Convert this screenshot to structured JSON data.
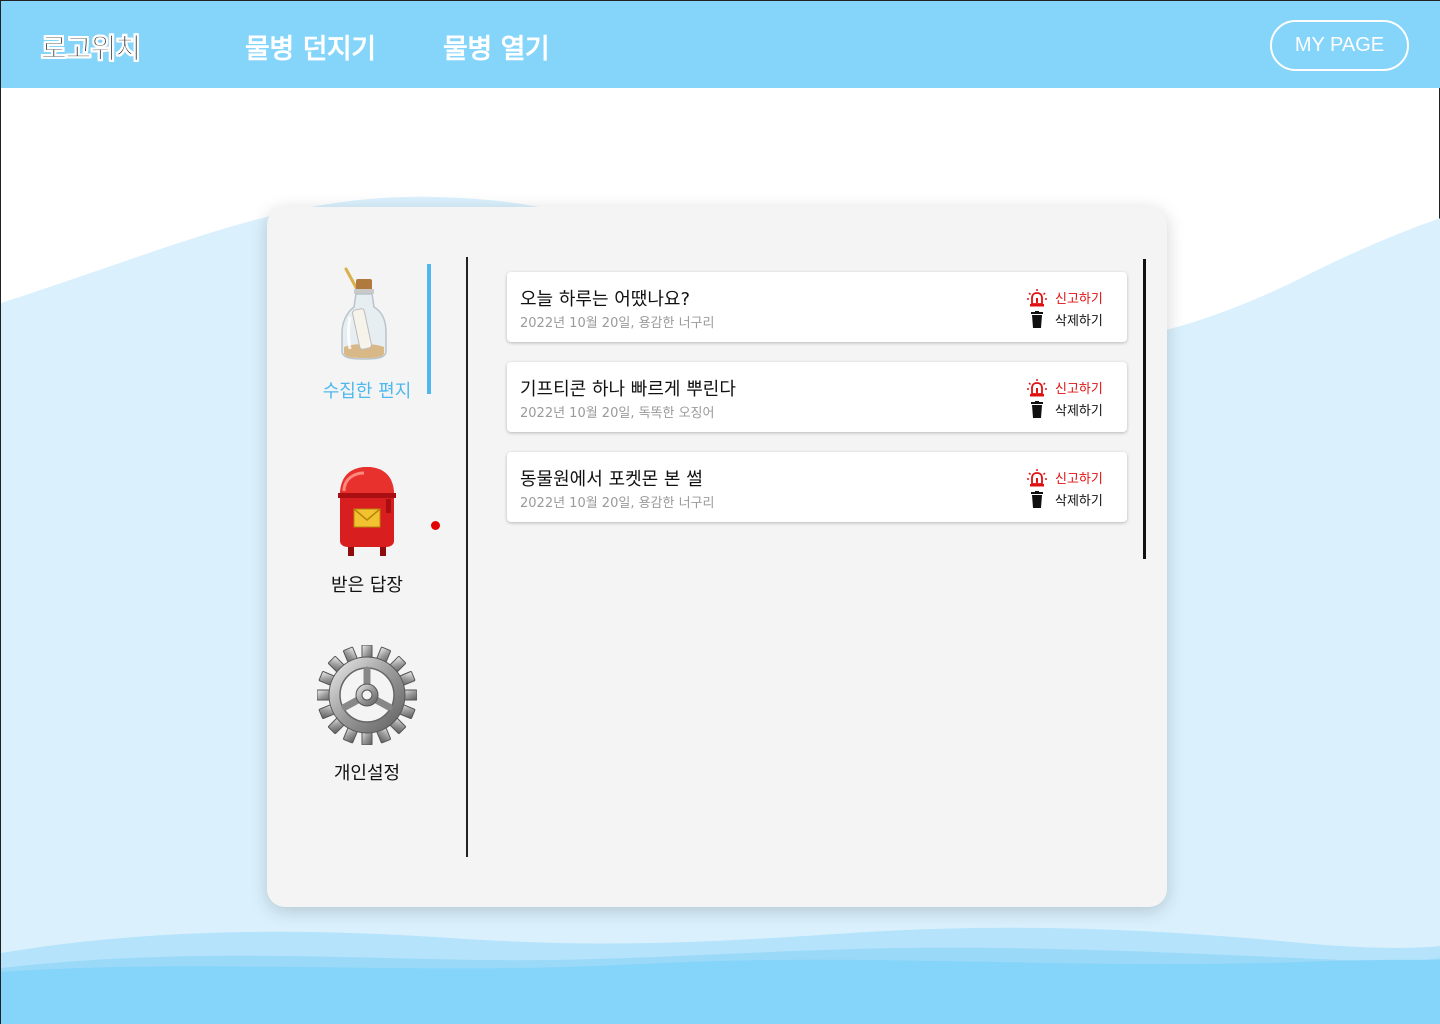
{
  "header": {
    "logo": "로고위치",
    "nav": {
      "throw_bottle": "물병 던지기",
      "open_bottle": "물병 열기"
    },
    "mypage": "MY PAGE",
    "bg_color": "#85d4fa"
  },
  "sidebar": {
    "items": [
      {
        "label": "수집한 편지",
        "icon": "message-bottle-icon",
        "active": true
      },
      {
        "label": "받은 답장",
        "icon": "red-mailbox-icon",
        "active": false,
        "has_notification": true
      },
      {
        "label": "개인설정",
        "icon": "gear-icon",
        "active": false
      }
    ],
    "active_color": "#4fb9ef"
  },
  "letters": [
    {
      "title": "오늘 하루는 어땠나요?",
      "meta": "2022년 10월 20일, 용감한 너구리",
      "report": "신고하기",
      "delete": "삭제하기"
    },
    {
      "title": "기프티콘 하나 빠르게 뿌린다",
      "meta": "2022년 10월 20일, 독똑한 오징어",
      "report": "신고하기",
      "delete": "삭제하기"
    },
    {
      "title": "동물원에서 포켓몬 본 썰",
      "meta": "2022년 10월 20일, 용감한 너구리",
      "report": "신고하기",
      "delete": "삭제하기"
    }
  ],
  "colors": {
    "report": "#e01010",
    "wave_light": "#daf1fd",
    "wave_dark": "#85d4fa"
  }
}
